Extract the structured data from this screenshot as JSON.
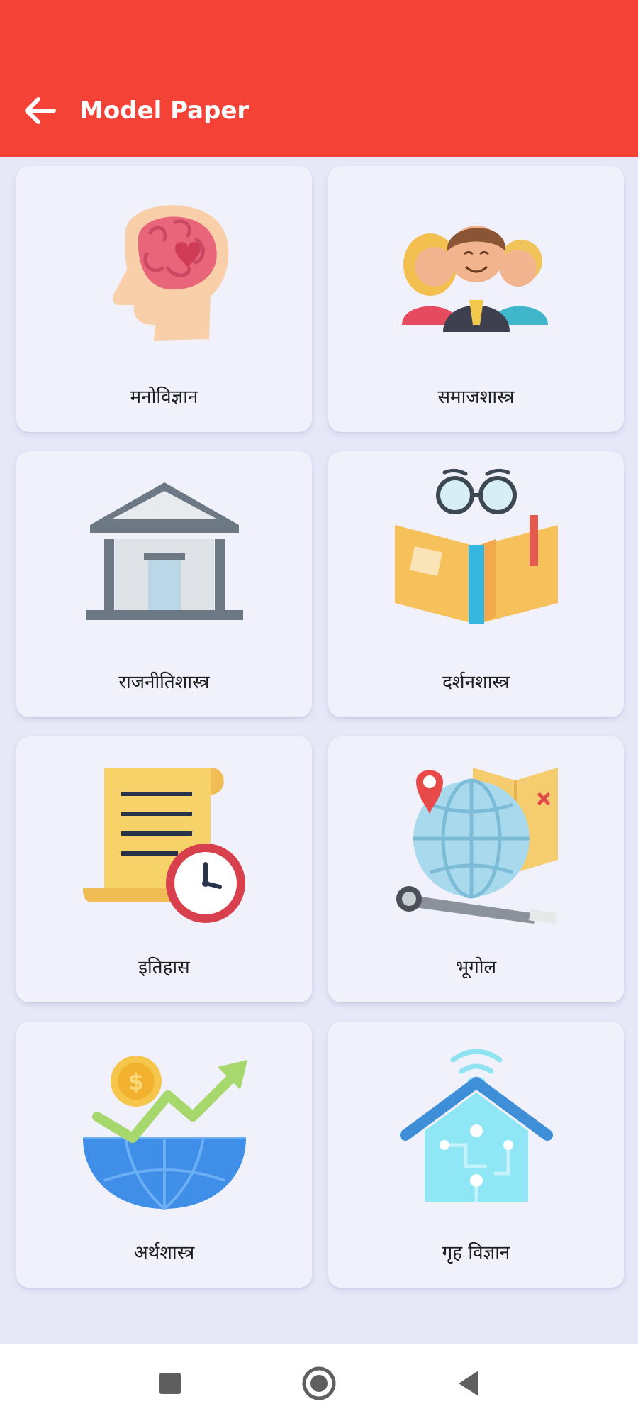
{
  "appbar": {
    "title": "Model Paper",
    "back_icon": "arrow-left-icon",
    "background": "#f44336"
  },
  "subjects": [
    {
      "label": "मनोविज्ञान",
      "icon": "brain-head-icon"
    },
    {
      "label": "समाजशास्त्र",
      "icon": "people-group-icon"
    },
    {
      "label": "राजनीतिशास्त्र",
      "icon": "government-building-icon"
    },
    {
      "label": "दर्शनशास्त्र",
      "icon": "open-book-glasses-icon"
    },
    {
      "label": "इतिहास",
      "icon": "scroll-clock-icon"
    },
    {
      "label": "भूगोल",
      "icon": "globe-map-telescope-icon"
    },
    {
      "label": "अर्थशास्त्र",
      "icon": "economy-growth-icon"
    },
    {
      "label": "गृह विज्ञान",
      "icon": "smart-home-icon"
    }
  ],
  "navbar": {
    "recents_icon": "square-icon",
    "home_icon": "circle-home-icon",
    "back_icon": "triangle-back-icon"
  }
}
